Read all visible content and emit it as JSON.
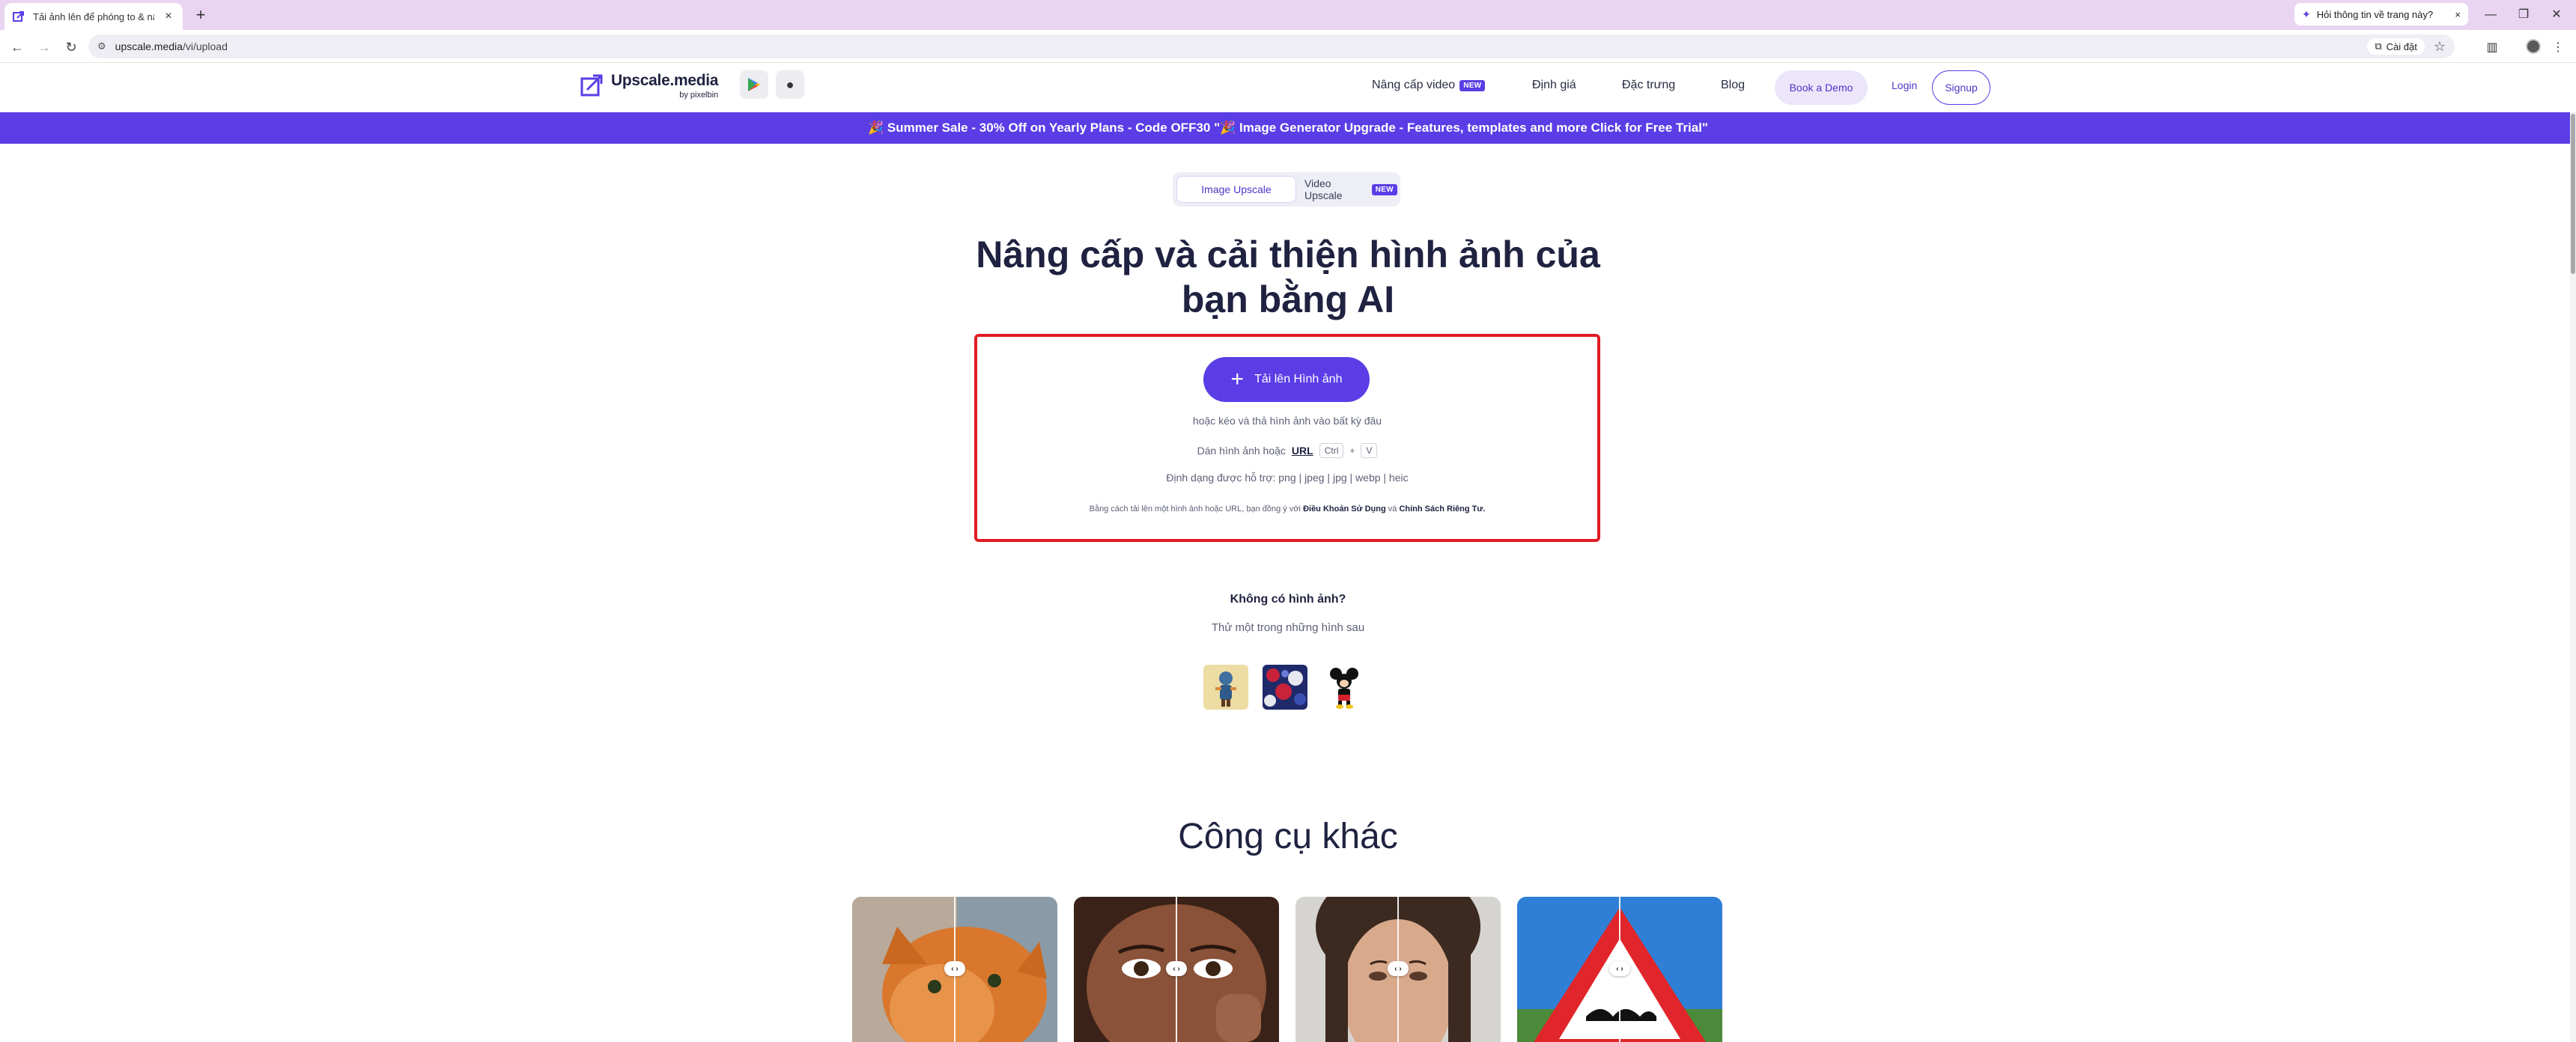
{
  "browser": {
    "tab_title": "Tải ảnh lên để phóng to & nâng",
    "side_chip": "Hỏi thông tin về trang này?",
    "url_host": "upscale.media",
    "url_path": "/vi/upload",
    "install_label": "Cài đặt"
  },
  "header": {
    "logo_name": "Upscale.media",
    "logo_sub": "by pixelbin",
    "nav": {
      "video": "Nâng cấp video",
      "video_badge": "NEW",
      "pricing": "Định giá",
      "features": "Đặc trưng",
      "blog": "Blog"
    },
    "demo": "Book a Demo",
    "login": "Login",
    "signup": "Signup"
  },
  "promo": {
    "text": "🎉 Summer Sale - 30% Off on Yearly Plans - Code OFF30   \"🎉 Image Generator Upgrade - Features, templates and more Click for Free Trial\""
  },
  "toggle": {
    "image": "Image Upscale",
    "video": "Video Upscale",
    "video_badge": "NEW"
  },
  "hero": {
    "title_line1": "Nâng cấp và cải thiện hình ảnh của",
    "title_line2": "bạn bằng AI"
  },
  "upload": {
    "button": "Tải lên Hình ảnh",
    "drag": "hoặc kéo và thả hình ảnh vào bất kỳ đâu",
    "paste_prefix": "Dán hình ảnh hoặc",
    "paste_url": "URL",
    "key_ctrl": "Ctrl",
    "key_plus": "+",
    "key_v": "V",
    "formats": "Định dạng được hỗ trợ: png | jpeg | jpg | webp | heic",
    "terms_prefix": "Bằng cách tải lên một hình ảnh hoặc URL, bạn đồng ý với",
    "terms_link": "Điều Khoản Sử Dụng",
    "terms_and": "và",
    "privacy_link": "Chính Sách Riêng Tư."
  },
  "samples": {
    "title": "Không có hình ảnh?",
    "subtitle": "Thử một trong những hình sau"
  },
  "tools": {
    "title": "Công cụ khác",
    "handle": "‹ ›"
  },
  "colors": {
    "brand": "#5b3de6",
    "highlight_border": "#e11b22",
    "tab_strip": "#e9d4f2"
  }
}
